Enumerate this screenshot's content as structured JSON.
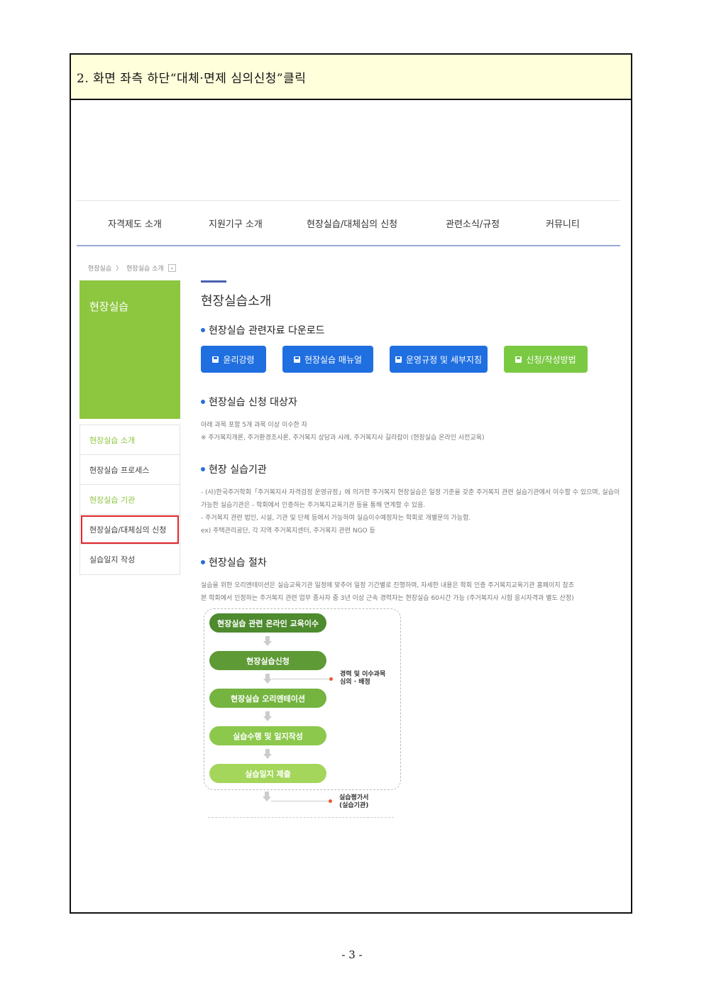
{
  "step_instruction": "2. 화면 좌측 하단“대체·면제 심의신청”클릭",
  "nav": [
    "자격제도 소개",
    "지원기구 소개",
    "현장실습/대체심의 신청",
    "관련소식/규정",
    "커뮤니티"
  ],
  "breadcrumb": {
    "home": "현장실습",
    "separator": "〉",
    "current": "현장실습 소개",
    "dropdown": "⌄"
  },
  "sidebar": {
    "hero_title": "현장실습",
    "items": [
      "현장실습 소개",
      "현장실습 프로세스",
      "현장실습 기관",
      "현장실습/대체심의 신청",
      "실습일지 작성"
    ]
  },
  "main": {
    "page_title": "현장실습소개",
    "download": {
      "title": "현장실습 관련자료 다운로드",
      "buttons": [
        "윤리강령",
        "현장실습 매뉴얼",
        "운영규정 및 세부지침",
        "신청/작성방법"
      ]
    },
    "target": {
      "title": "현장실습 신청 대상자",
      "lines": [
        "아래 과목 포함 5개 과목 이상 이수한 자",
        "※ 주거복지개론, 주거환경조사론, 주거복지 상담과 사례, 주거복지사 길라잡이 (현장실습 온라인 사전교육)"
      ]
    },
    "institution": {
      "title": "현장 실습기관",
      "lines": [
        "- (사)한국주거학회「주거복지사 자격검정 운영규정」에 의거한 주거복지 현장실습은 일정 기준을 갖춘 주거복지 관련 실습기관에서 이수할 수 있으며, 실습이",
        "가능한 실습기관은 - 학회에서 인증하는 주거복지교육기관 등을 통해 연계할 수 있음.",
        "- 주거복지 관련 법인, 시설, 기관 및 단체 등에서 가능하며 실습이수예정자는 학회로 개별문의 가능함.",
        "ex) 주택관리공단, 각 지역 주거복지센터, 주거복지 관련 NGO 등"
      ]
    },
    "procedure": {
      "title": "현장실습 절차",
      "lines": [
        "실습을 위한 오리엔테이션은 실습교육기관 일정에 맞추어 일정 기간별로 진행하며, 자세한 내용은 학회 인증 주거복지교육기관 홈페이지 참조",
        "본 학회에서 인정하는 주거복지 관련 업무 종사자 중 3년 이상 근속 경력자는 현장실습 60시간 가능 (주거복지사 시험 응시자격과 별도 산정)"
      ],
      "steps": [
        "현장실습 관련 온라인 교육이수",
        "현장실습신청",
        "현장실습 오리엔테이션",
        "실습수행 및 일지작성",
        "실습일지 제출"
      ],
      "note1": [
        "경력 및 이수과목",
        "심의 · 배정"
      ],
      "note2": [
        "실습평가서",
        "(실습기관)"
      ]
    }
  },
  "page_number": "- 3 -",
  "colors": {
    "green": "#8dc63f",
    "blue_button": "#1f6fe0",
    "highlight_box": "#e0262a",
    "header_bg": "#ffffdc"
  }
}
